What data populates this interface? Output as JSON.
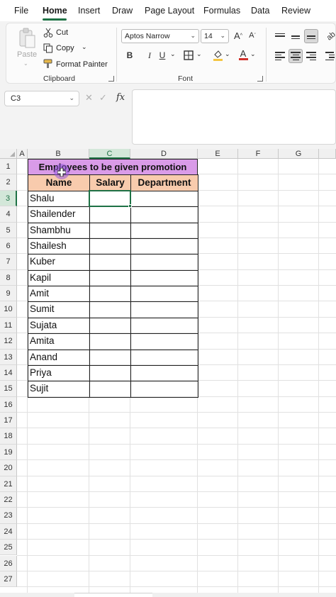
{
  "ribbon": {
    "tabs": [
      {
        "label": "File"
      },
      {
        "label": "Home"
      },
      {
        "label": "Insert"
      },
      {
        "label": "Draw"
      },
      {
        "label": "Page Layout"
      },
      {
        "label": "Formulas"
      },
      {
        "label": "Data"
      },
      {
        "label": "Review"
      }
    ],
    "active_tab": "Home",
    "clipboard": {
      "paste": "Paste",
      "cut": "Cut",
      "copy": "Copy",
      "format_painter": "Format Painter",
      "group_label": "Clipboard"
    },
    "font": {
      "name": "Aptos Narrow",
      "size": "14",
      "group_label": "Font",
      "bold": "B",
      "italic": "I",
      "underline": "U",
      "grow": "A",
      "shrink": "A",
      "font_color": "A"
    }
  },
  "formula_bar": {
    "name_box": "C3",
    "fx": "fx",
    "formula": ""
  },
  "grid": {
    "columns": [
      "A",
      "B",
      "C",
      "D",
      "E",
      "F",
      "G"
    ],
    "rows": [
      "1",
      "2",
      "3",
      "4",
      "5",
      "6",
      "7",
      "8",
      "9",
      "10",
      "11",
      "12",
      "13",
      "14",
      "15",
      "16",
      "17",
      "18",
      "19",
      "20",
      "21",
      "22",
      "23",
      "24",
      "25",
      "26",
      "27"
    ],
    "selected_cell": "C3",
    "title": "Employees to be given promotion",
    "headers": [
      "Name",
      "Salary",
      "Department"
    ],
    "names": [
      "Shalu",
      "Shailender",
      "Shambhu",
      "Shailesh",
      "Kuber",
      "Kapil",
      "Amit",
      "Sumit",
      "Sujata",
      "Amita",
      "Anand",
      "Priya",
      "Sujit"
    ]
  },
  "colors": {
    "accent": "#1e7145",
    "title_fill": "#d99be8",
    "header_fill": "#f8cbad",
    "cursor": "#9a5ee0"
  }
}
